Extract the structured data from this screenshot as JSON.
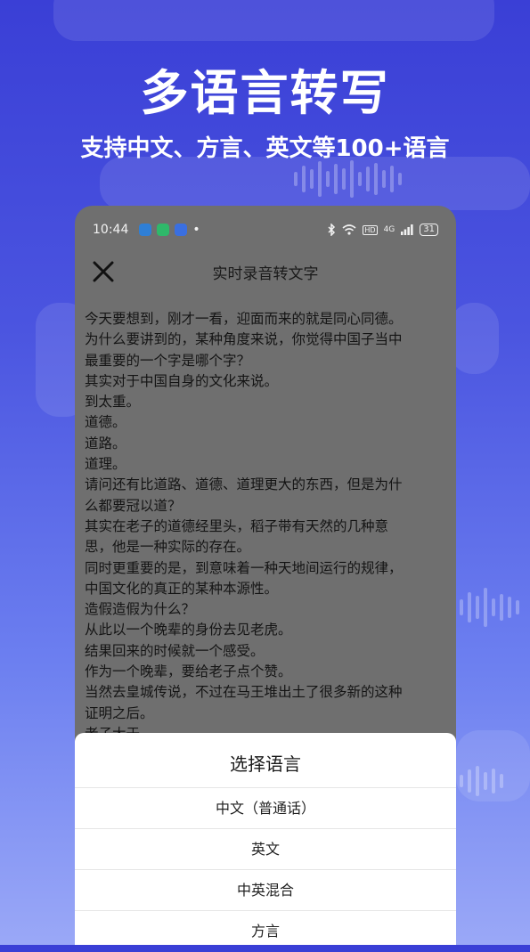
{
  "promo": {
    "headline": "多语言转写",
    "subline": "支持中文、方言、英文等100+语言"
  },
  "status_bar": {
    "time": "10:44",
    "dot": "•",
    "network": "4G",
    "hd": "HD",
    "battery": "31"
  },
  "nav": {
    "title": "实时录音转文字"
  },
  "transcript": {
    "lines": [
      "今天要想到，刚才一看，迎面而来的就是同心同德。",
      "为什么要讲到的，某种角度来说，你觉得中国子当中",
      "最重要的一个字是哪个字？",
      "其实对于中国自身的文化来说。",
      "到太重。",
      "道德。",
      "道路。",
      "道理。",
      "请问还有比道路、道德、道理更大的东西，但是为什",
      "么都要冠以道？",
      "其实在老子的道德经里头，稻子带有天然的几种意",
      "思，他是一种实际的存在。",
      "同时更重要的是，到意味着一种天地间运行的规律，",
      "中国文化的真正的某种本源性。",
      "造假造假为什么？",
      "从此以一个晚辈的身份去见老虎。",
      "结果回来的时候就一个感受。",
      "作为一个晚辈，要给老子点个赞。",
      "当然去皇城传说，不过在马王堆出土了很多新的这种",
      "证明之后。",
      "老子大于。"
    ]
  },
  "language_sheet": {
    "title": "选择语言",
    "options": [
      "中文（普通话）",
      "英文",
      "中英混合",
      "方言"
    ]
  },
  "colors": {
    "background_top": "#3a3fd6",
    "background_bottom": "#9aa8f7",
    "dim_overlay": "#6f6f6f",
    "sheet": "#ffffff"
  },
  "icons": [
    "close-icon",
    "bluetooth-icon",
    "wifi-icon",
    "signal-icon",
    "battery-icon"
  ]
}
